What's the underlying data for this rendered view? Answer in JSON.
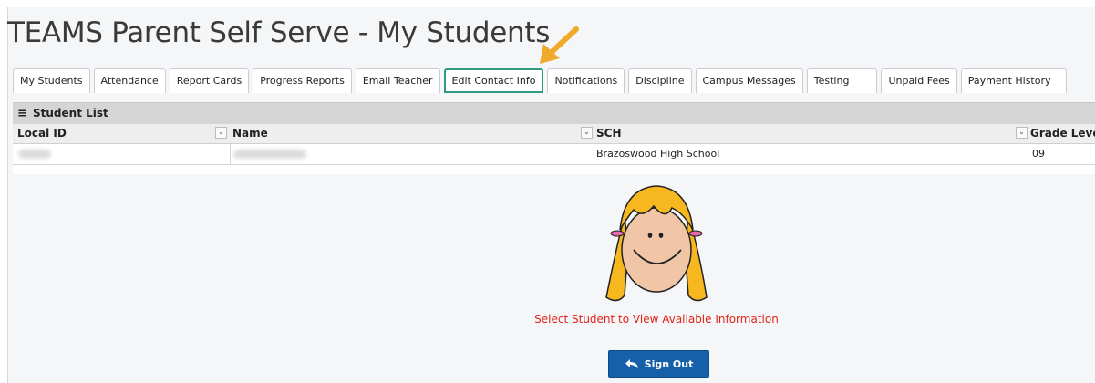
{
  "page_title": "TEAMS Parent Self Serve - My Students",
  "tabs": [
    {
      "label": "My Students"
    },
    {
      "label": "Attendance"
    },
    {
      "label": "Report Cards"
    },
    {
      "label": "Progress Reports"
    },
    {
      "label": "Email Teacher"
    },
    {
      "label": "Edit Contact Info"
    },
    {
      "label": "Notifications"
    },
    {
      "label": "Discipline"
    },
    {
      "label": "Campus Messages"
    },
    {
      "label": "Testing"
    },
    {
      "label": "Unpaid Fees"
    },
    {
      "label": "Payment History"
    }
  ],
  "highlighted_tab": "Edit Contact Info",
  "student_list": {
    "title": "Student List",
    "columns": [
      "Local ID",
      "Name",
      "SCH",
      "Grade Leve"
    ],
    "rows": [
      {
        "school": "Brazoswood High School",
        "grade": "09"
      }
    ]
  },
  "prompt_text": "Select Student to View Available Information",
  "signout_label": "Sign Out",
  "icons": {
    "list": "hamburger-icon",
    "column_menu": "chevron-down-icon",
    "signout": "reply-arrow-icon",
    "pointer": "pointer-arrow-icon",
    "avatar": "student-avatar-icon"
  },
  "colors": {
    "highlight_border": "#2e9b80",
    "arrow": "#f0a92a",
    "prompt": "#e2231a",
    "button": "#1560a8"
  }
}
